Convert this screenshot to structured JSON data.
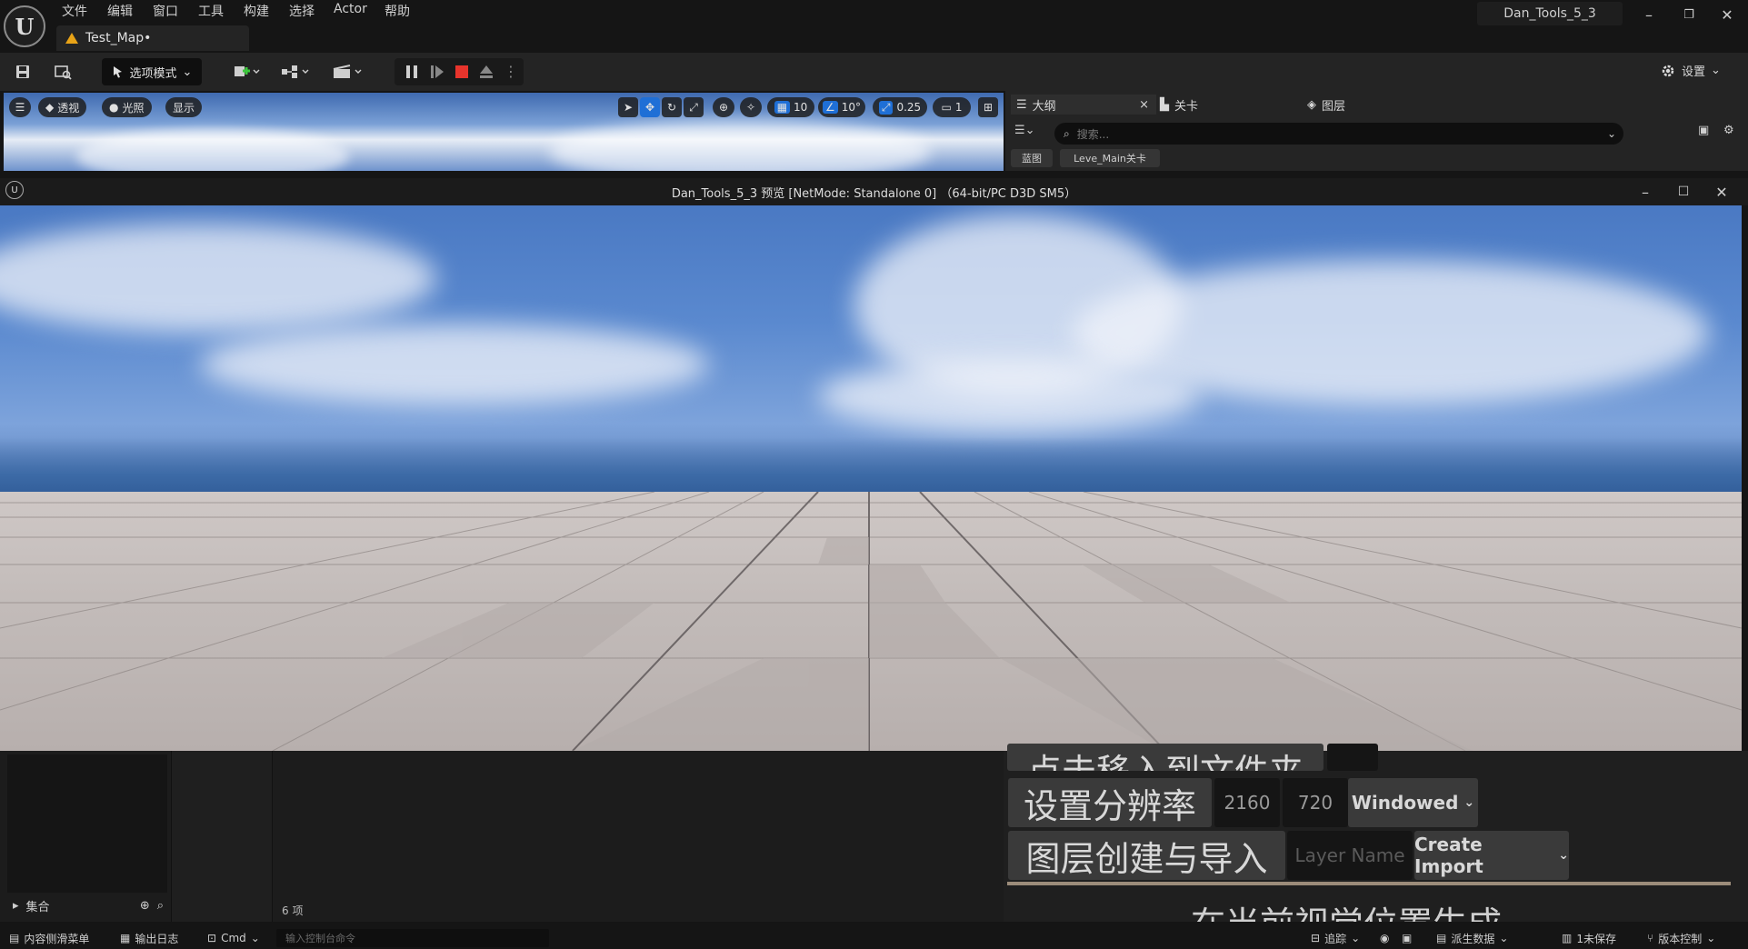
{
  "titlebar": {
    "logo": "U",
    "menu": [
      "文件",
      "编辑",
      "窗口",
      "工具",
      "构建",
      "选择",
      "Actor",
      "帮助"
    ],
    "map_tab": "Test_Map•",
    "project": "Dan_Tools_5_3",
    "win_min": "–",
    "win_restore": "❐",
    "win_close": "✕"
  },
  "toolbar": {
    "mode": "选项模式",
    "settings": "设置"
  },
  "viewport": {
    "perspective": "透视",
    "lighting": "光照",
    "show": "显示",
    "grid": "10",
    "angle": "10°",
    "scale": "0.25",
    "camera": "1"
  },
  "outliner": {
    "tabs": [
      "大纲",
      "关卡",
      "图层"
    ],
    "close": "×",
    "search_placeholder": "搜索...",
    "chips": [
      "蓝图",
      "Leve_Main关卡"
    ]
  },
  "pie": {
    "title": "Dan_Tools_5_3 预览 [NetMode: Standalone 0]  （64-bit/PC D3D SM5）",
    "min": "–",
    "max": "☐",
    "close": "✕"
  },
  "bottom": {
    "collection": "集合",
    "item_count": "6 项"
  },
  "tool": {
    "partial_top": "点击移入到文件夹",
    "resolution_label": "设置分辨率",
    "res_w": "2160",
    "res_h": "720",
    "window_mode": "Windowed",
    "layer_label": "图层创建与导入",
    "layer_placeholder": "Layer Name",
    "import_label": "Create Import",
    "partial_bottom": "在当前视觉位置生成"
  },
  "statusbar": {
    "drawer": "内容侧滑菜单",
    "output": "输出日志",
    "cmd": "Cmd",
    "console_placeholder": "输入控制台命令",
    "trace": "追踪",
    "derived": "派生数据",
    "unsaved": "1未保存",
    "source": "版本控制"
  }
}
